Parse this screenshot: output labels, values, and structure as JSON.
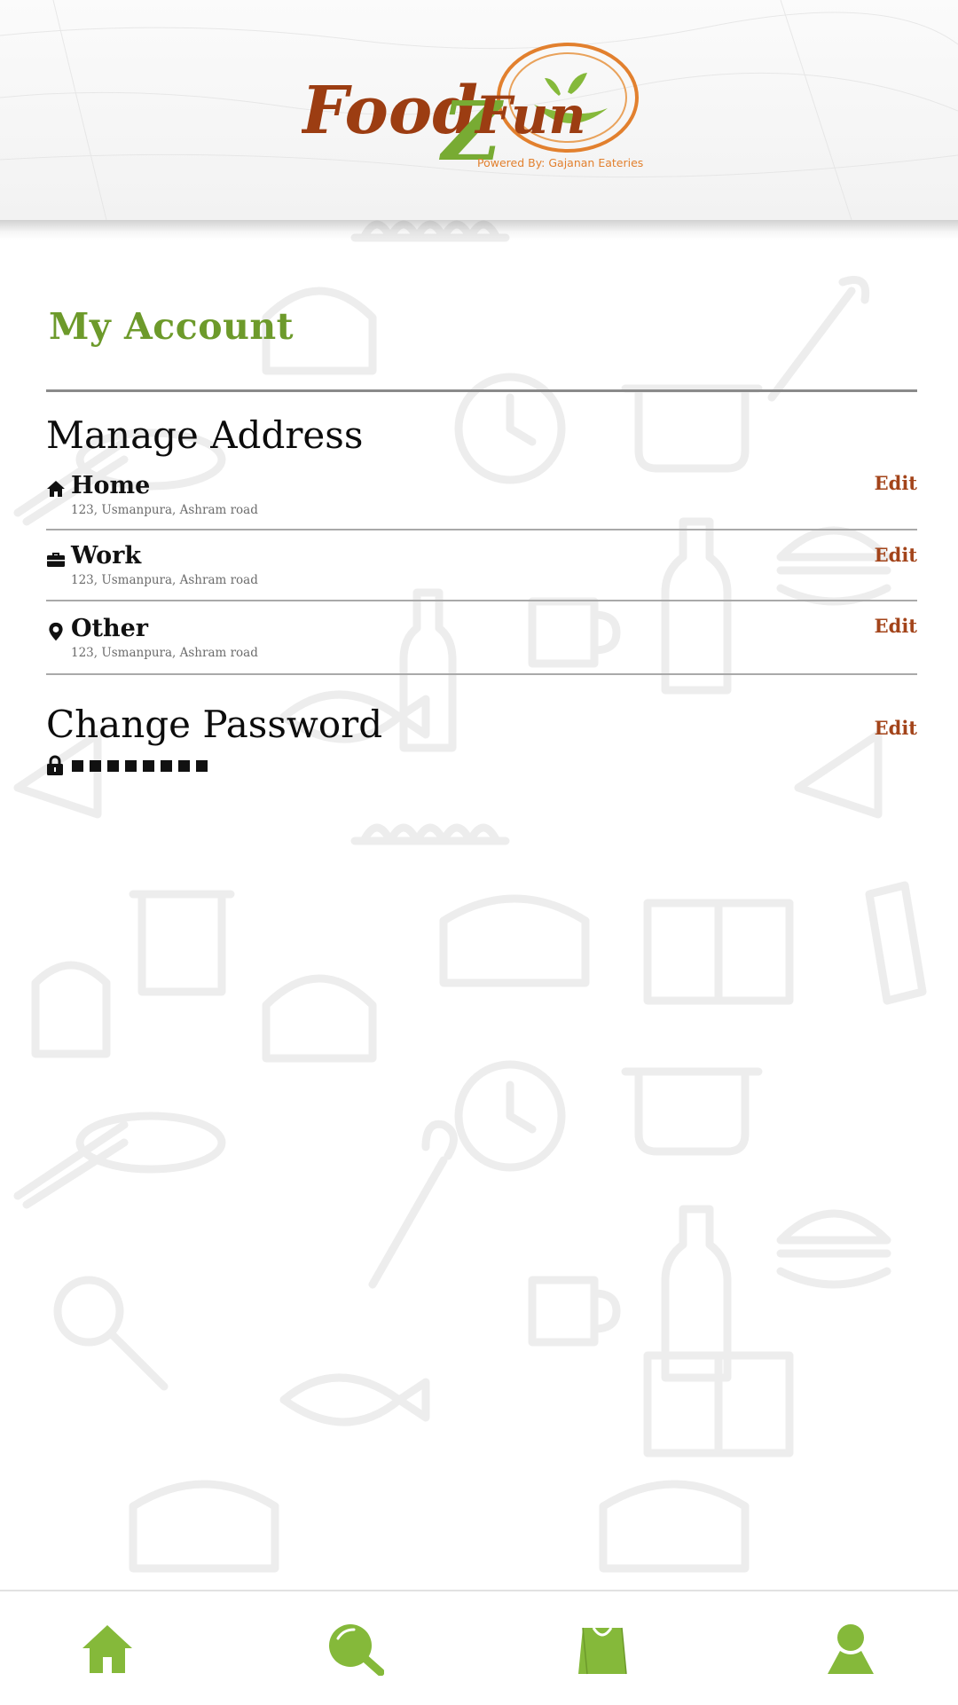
{
  "brand": {
    "logo_word_1": "Food",
    "logo_word_2": "Z",
    "logo_word_3": "Fun",
    "tagline": "Powered By: Gajanan Eateries",
    "colors": {
      "primary_green": "#6d9a2b",
      "icon_green": "#85b93a",
      "brand_rust": "#a3441a",
      "logo_orange": "#e2802e"
    }
  },
  "page": {
    "title": "My Account"
  },
  "addresses": {
    "section_title": "Manage Address",
    "items": [
      {
        "icon": "home-icon",
        "label": "Home",
        "address": "123, Usmanpura, Ashram road",
        "edit_label": "Edit"
      },
      {
        "icon": "briefcase-icon",
        "label": "Work",
        "address": "123, Usmanpura, Ashram road",
        "edit_label": "Edit"
      },
      {
        "icon": "map-pin-icon",
        "label": "Other",
        "address": "123, Usmanpura, Ashram road",
        "edit_label": "Edit"
      }
    ]
  },
  "password": {
    "section_title": "Change Password",
    "edit_label": "Edit",
    "icon": "lock-icon",
    "masked_value": "••••••••",
    "mask_length": 8
  },
  "bottom_nav": {
    "items": [
      {
        "icon": "home-icon",
        "name": "nav-home"
      },
      {
        "icon": "search-icon",
        "name": "nav-search"
      },
      {
        "icon": "shopping-bag-icon",
        "name": "nav-bag"
      },
      {
        "icon": "user-icon",
        "name": "nav-account"
      }
    ]
  }
}
